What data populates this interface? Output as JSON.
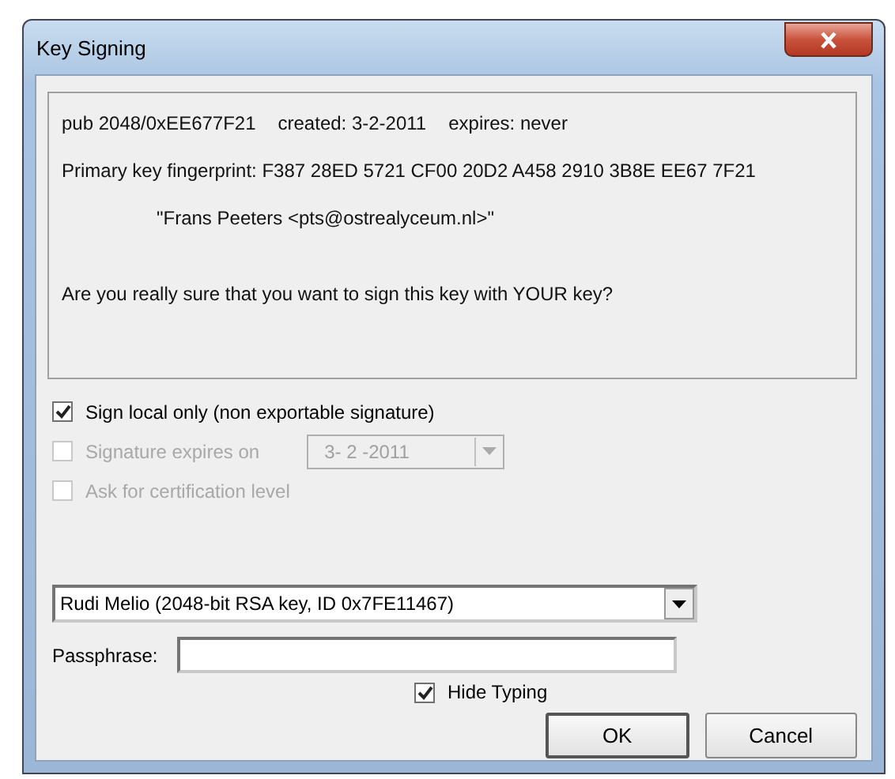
{
  "window": {
    "title": "Key Signing"
  },
  "info": {
    "lines": [
      {
        "kind": "plain",
        "text": "pub 2048/0xEE677F21"
      },
      {
        "kind": "inline",
        "text": "created: 3-2-2011"
      },
      {
        "kind": "inline",
        "text": "expires: never"
      },
      {
        "kind": "plain",
        "text": "Primary key fingerprint: F387 28ED 5721 CF00 20D2 A458 2910 3B8E EE67 7F21"
      },
      {
        "kind": "indented",
        "text": "\"Frans Peeters <pts@ostrealyceum.nl>\""
      },
      {
        "kind": "spaced",
        "text": "Are you really sure that you want to sign this key with YOUR key?"
      }
    ]
  },
  "options": [
    {
      "kind": "checkbox",
      "label": "Sign local only (non exportable signature)",
      "checked": true,
      "disabled": false
    },
    {
      "kind": "date",
      "label": "Signature expires on",
      "checked": false,
      "disabled": true,
      "date": "3- 2 -2011"
    },
    {
      "kind": "checkbox",
      "label": "Ask for certification level",
      "checked": false,
      "disabled": true
    }
  ],
  "key_select": {
    "value": "Rudi Melio (2048-bit RSA key, ID 0x7FE11467)"
  },
  "passphrase": {
    "label": "Passphrase:"
  },
  "hide_typing": {
    "label": "Hide Typing",
    "checked": true
  },
  "buttons": [
    {
      "label": "OK",
      "default": true
    },
    {
      "label": "Cancel",
      "default": false
    }
  ]
}
